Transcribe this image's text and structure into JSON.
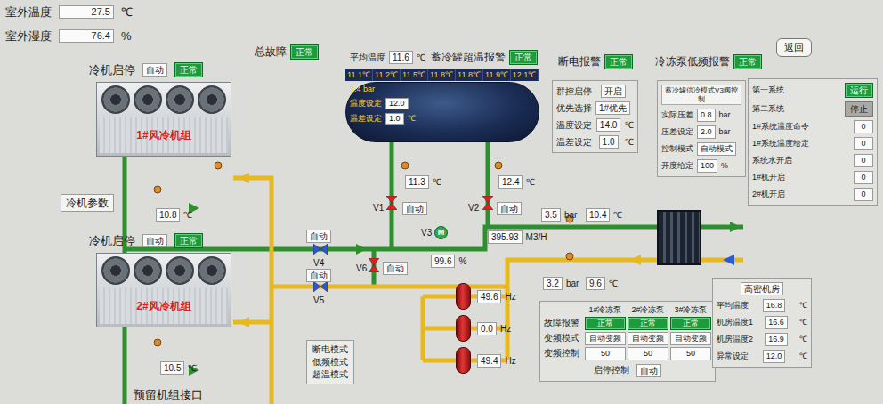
{
  "outdoor": [
    {
      "label": "室外温度",
      "value": "27.5",
      "unit": "℃"
    },
    {
      "label": "室外湿度",
      "value": "76.4",
      "unit": "%"
    }
  ],
  "alarms": [
    {
      "label": "总故障",
      "status": "正常",
      "ok": true
    },
    {
      "label": "蓄冷罐超温报警",
      "status": "正常",
      "ok": true
    },
    {
      "label": "断电报警",
      "status": "正常",
      "ok": true
    },
    {
      "label": "冷冻泵低频报警",
      "status": "正常",
      "ok": true
    }
  ],
  "back_button": "返回",
  "tank": {
    "avg": {
      "label": "平均温度",
      "value": "11.6",
      "unit": "℃"
    },
    "temps": [
      "11.1℃",
      "11.2℃",
      "11.5℃",
      "11.8℃",
      "11.8℃",
      "11.9℃",
      "12.1℃"
    ],
    "pressure": "3.4 bar",
    "settings": [
      {
        "label": "温度设定",
        "value": "12.0",
        "unit": ""
      },
      {
        "label": "温差设定",
        "value": "1.0",
        "unit": "℃"
      }
    ]
  },
  "chillers": [
    {
      "start_label": "冷机启停",
      "mode": "自动",
      "status": "正常",
      "ok": true,
      "name": "1#风冷机组"
    },
    {
      "start_label": "冷机启停",
      "mode": "自动",
      "status": "正常",
      "ok": true,
      "name": "2#风冷机组"
    }
  ],
  "chiller_params": "冷机参数",
  "reserved_port": "预留机组接口",
  "valves": [
    {
      "name": "V1",
      "mode": "自动",
      "color": "#e02020",
      "kind": "vertical"
    },
    {
      "name": "V2",
      "mode": "自动",
      "color": "#e02020",
      "kind": "vertical"
    },
    {
      "name": "V3",
      "symbol": "M",
      "opening": "99.6",
      "unit": "%",
      "color": "#2ea84a",
      "kind": "motor"
    },
    {
      "name": "V4",
      "mode": "自动",
      "color": "#2f55d4",
      "kind": "horizontal"
    },
    {
      "name": "V5",
      "mode": "自动",
      "color": "#2f55d4",
      "kind": "horizontal"
    },
    {
      "name": "V6",
      "mode": "自动",
      "color": "#e02020",
      "kind": "vertical"
    }
  ],
  "readings": [
    {
      "value": "11.3",
      "unit": "℃"
    },
    {
      "value": "12.4",
      "unit": "℃"
    },
    {
      "value": "3.5",
      "unit": "bar"
    },
    {
      "value": "10.4",
      "unit": "℃"
    },
    {
      "value": "395.93",
      "unit": "M3/H"
    },
    {
      "value": "3.2",
      "unit": "bar"
    },
    {
      "value": "9.6",
      "unit": "℃"
    },
    {
      "value": "10.8",
      "unit": "℃"
    },
    {
      "value": "10.5",
      "unit": "℃"
    }
  ],
  "pumps": [
    {
      "freq": "49.6",
      "unit": "Hz"
    },
    {
      "freq": "0.0",
      "unit": "Hz"
    },
    {
      "freq": "49.4",
      "unit": "Hz"
    }
  ],
  "group_control": [
    {
      "label": "群控启停",
      "value": "开启",
      "unit": ""
    },
    {
      "label": "优先选择",
      "value": "1#优先",
      "unit": ""
    },
    {
      "label": "温度设定",
      "value": "14.0",
      "unit": "℃"
    },
    {
      "label": "温差设定",
      "value": "1.0",
      "unit": "℃"
    }
  ],
  "v3_control": {
    "title": "蓄冷罐供冷模式V3阀控制",
    "rows": [
      {
        "label": "实际压差",
        "value": "0.8",
        "unit": "bar"
      },
      {
        "label": "压差设定",
        "value": "2.0",
        "unit": "bar"
      },
      {
        "label": "控制模式",
        "value": "自动模式",
        "unit": ""
      },
      {
        "label": "开度给定",
        "value": "100",
        "unit": "%"
      }
    ]
  },
  "systems": {
    "buttons": [
      {
        "label": "第一系统",
        "status": "运行",
        "selected": true
      },
      {
        "label": "第二系统",
        "status": "停止",
        "selected": false
      }
    ],
    "rows": [
      {
        "label": "1#系统温度命令",
        "value": "0"
      },
      {
        "label": "1#系统温度给定",
        "value": "0"
      },
      {
        "label": "系统水开启",
        "value": "0"
      },
      {
        "label": "1#机开启",
        "value": "0"
      },
      {
        "label": "2#机开启",
        "value": "0"
      }
    ]
  },
  "modes": [
    "断电模式",
    "低频模式",
    "超温模式"
  ],
  "pump_panel": {
    "columns": [
      "1#冷冻泵",
      "2#冷冻泵",
      "3#冷冻泵"
    ],
    "rows": [
      {
        "label": "故障报警",
        "kind": "status",
        "cells": [
          "正常",
          "正常",
          "正常"
        ]
      },
      {
        "label": "变频模式",
        "kind": "text",
        "cells": [
          "自动变频",
          "自动变频",
          "自动变频"
        ]
      },
      {
        "label": "变频控制",
        "kind": "text",
        "cells": [
          "50",
          "50",
          "50"
        ]
      }
    ],
    "start_label": "启停控制",
    "start_value": "自动"
  },
  "machine_room": {
    "title": "高密机房",
    "rows": [
      {
        "label": "平均温度",
        "value": "16.8",
        "unit": "℃"
      },
      {
        "label": "机房温度1",
        "value": "16.6",
        "unit": "℃"
      },
      {
        "label": "机房温度2",
        "value": "16.9",
        "unit": "℃"
      },
      {
        "label": "异常设定",
        "value": "12.0",
        "unit": "℃"
      }
    ]
  }
}
